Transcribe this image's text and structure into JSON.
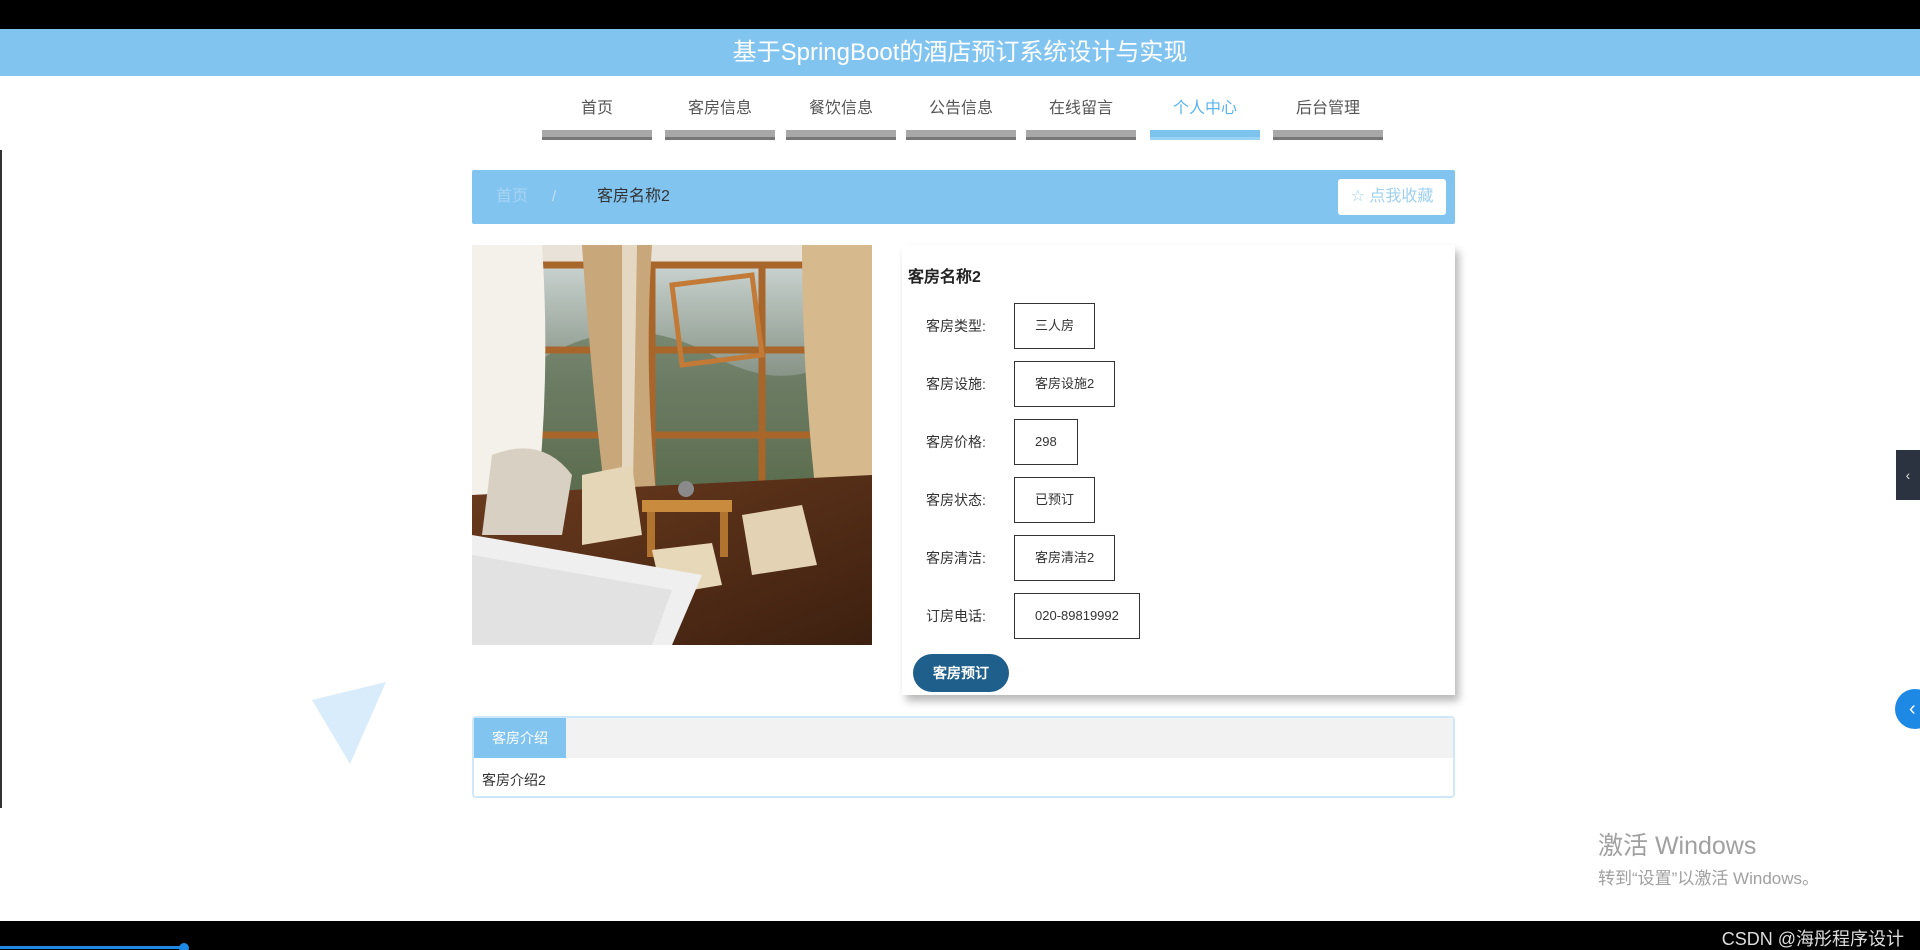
{
  "site_title": "基于SpringBoot的酒店预订系统设计与实现",
  "nav": {
    "items": [
      {
        "label": "首页",
        "active": false
      },
      {
        "label": "客房信息",
        "active": false
      },
      {
        "label": "餐饮信息",
        "active": false
      },
      {
        "label": "公告信息",
        "active": false
      },
      {
        "label": "在线留言",
        "active": false
      },
      {
        "label": "个人中心",
        "active": true
      },
      {
        "label": "后台管理",
        "active": false
      }
    ]
  },
  "breadcrumb": {
    "home": "首页",
    "separator": "/",
    "current": "客房名称2",
    "favorite_label": "☆ 点我收藏"
  },
  "room": {
    "name": "客房名称2",
    "fields": [
      {
        "label": "客房类型:",
        "value": "三人房"
      },
      {
        "label": "客房设施:",
        "value": "客房设施2"
      },
      {
        "label": "客房价格:",
        "value": "298"
      },
      {
        "label": "客房状态:",
        "value": "已预订"
      },
      {
        "label": "客房清洁:",
        "value": "客房清洁2"
      },
      {
        "label": "订房电话:",
        "value": "020-89819992"
      }
    ],
    "book_label": "客房预订"
  },
  "intro": {
    "tab_label": "客房介绍",
    "content": "客房介绍2"
  },
  "overlay": {
    "activate_title": "激活 Windows",
    "activate_sub": "转到“设置”以激活 Windows。",
    "watermark": "CSDN @海彤程序设计"
  },
  "colors": {
    "accent": "#82c4f0",
    "book_button": "#1e5f8c",
    "nav_active": "#5ab4ea"
  }
}
